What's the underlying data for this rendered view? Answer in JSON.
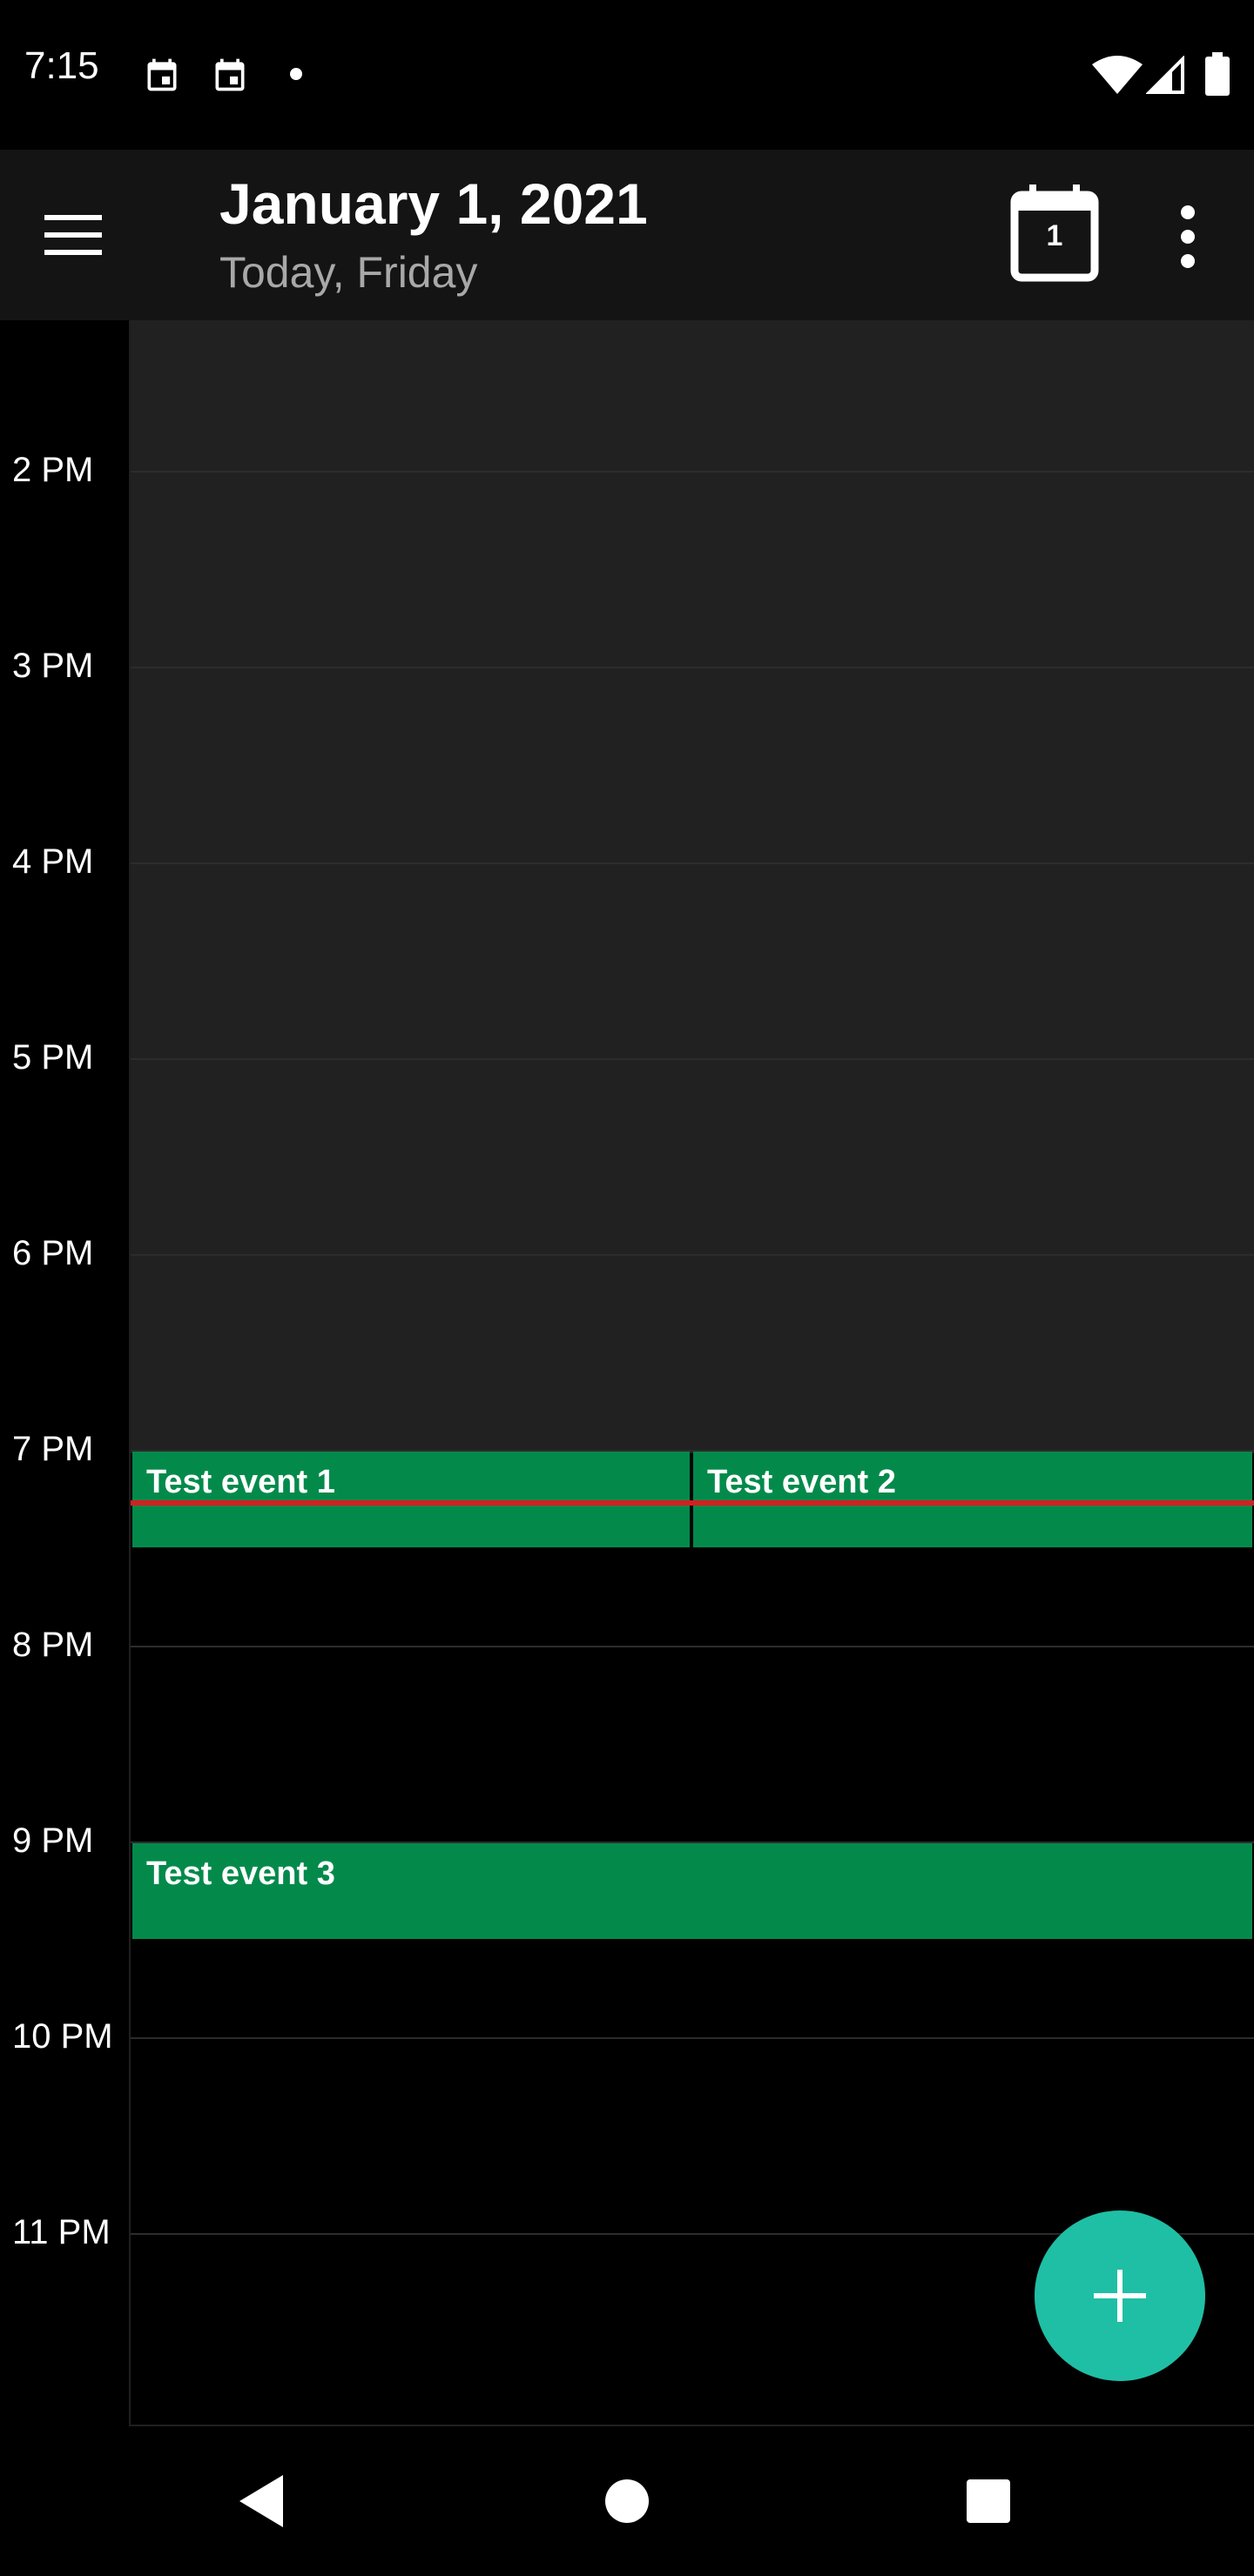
{
  "status_bar": {
    "time": "7:15",
    "left_icons": [
      "calendar-notification-icon",
      "calendar-notification-icon",
      "more-notifications-dot-icon"
    ],
    "right_icons": [
      "wifi-icon",
      "cellular-signal-icon",
      "battery-icon"
    ]
  },
  "app_bar": {
    "menu_icon": "hamburger-menu-icon",
    "title": "January 1, 2021",
    "subtitle": "Today, Friday",
    "today_button_number": "1",
    "overflow_icon": "more-vert-icon"
  },
  "timeline": {
    "hours": [
      "2 PM",
      "3 PM",
      "4 PM",
      "5 PM",
      "6 PM",
      "7 PM",
      "8 PM",
      "9 PM",
      "10 PM",
      "11 PM"
    ],
    "events": [
      {
        "title": "Test event 1",
        "start": "7 PM",
        "end": "7:30 PM"
      },
      {
        "title": "Test event 2",
        "start": "7 PM",
        "end": "7:30 PM"
      },
      {
        "title": "Test event 3",
        "start": "9 PM",
        "end": "9:30 PM"
      }
    ],
    "current_time": "7:15",
    "past_background_color": "#212121",
    "event_color": "#038a4b",
    "now_line_color": "#d32020"
  },
  "fab": {
    "icon": "plus-icon",
    "color": "#1fbfa5"
  },
  "nav_bar": {
    "buttons": [
      "back-icon",
      "home-icon",
      "recents-icon"
    ]
  }
}
